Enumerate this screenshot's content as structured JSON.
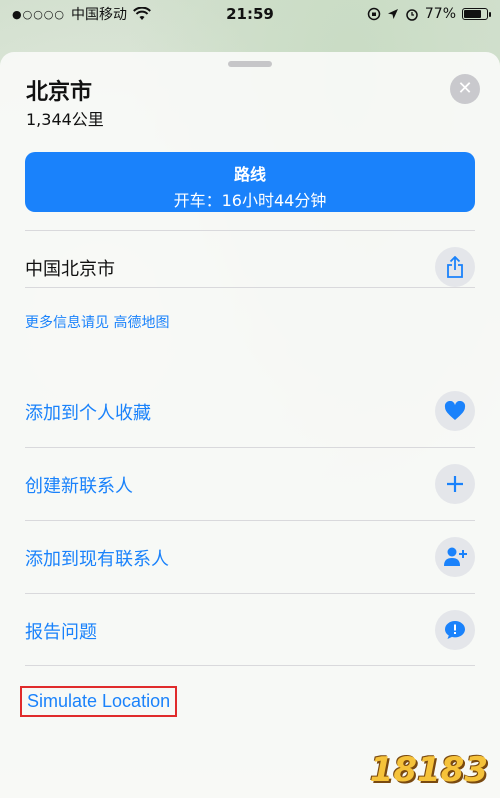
{
  "status_bar": {
    "signal": "●○○○○",
    "carrier": "中国移动",
    "time": "21:59",
    "battery": "77%",
    "battery_level": 0.77
  },
  "place": {
    "title": "北京市",
    "distance": "1,344公里"
  },
  "route_button": {
    "title": "路线",
    "time": "开车：16小时44分钟"
  },
  "address": "中国北京市",
  "more_info": "更多信息请见 高德地图",
  "actions": [
    {
      "label": "添加到个人收藏",
      "icon": "heart-icon"
    },
    {
      "label": "创建新联系人",
      "icon": "plus-icon"
    },
    {
      "label": "添加到现有联系人",
      "icon": "add-contact-icon"
    },
    {
      "label": "报告问题",
      "icon": "report-icon"
    }
  ],
  "simulate_location": "Simulate Location",
  "watermark": "18183",
  "colors": {
    "accent": "#1a82fb",
    "highlight_box": "#e02b2b"
  }
}
